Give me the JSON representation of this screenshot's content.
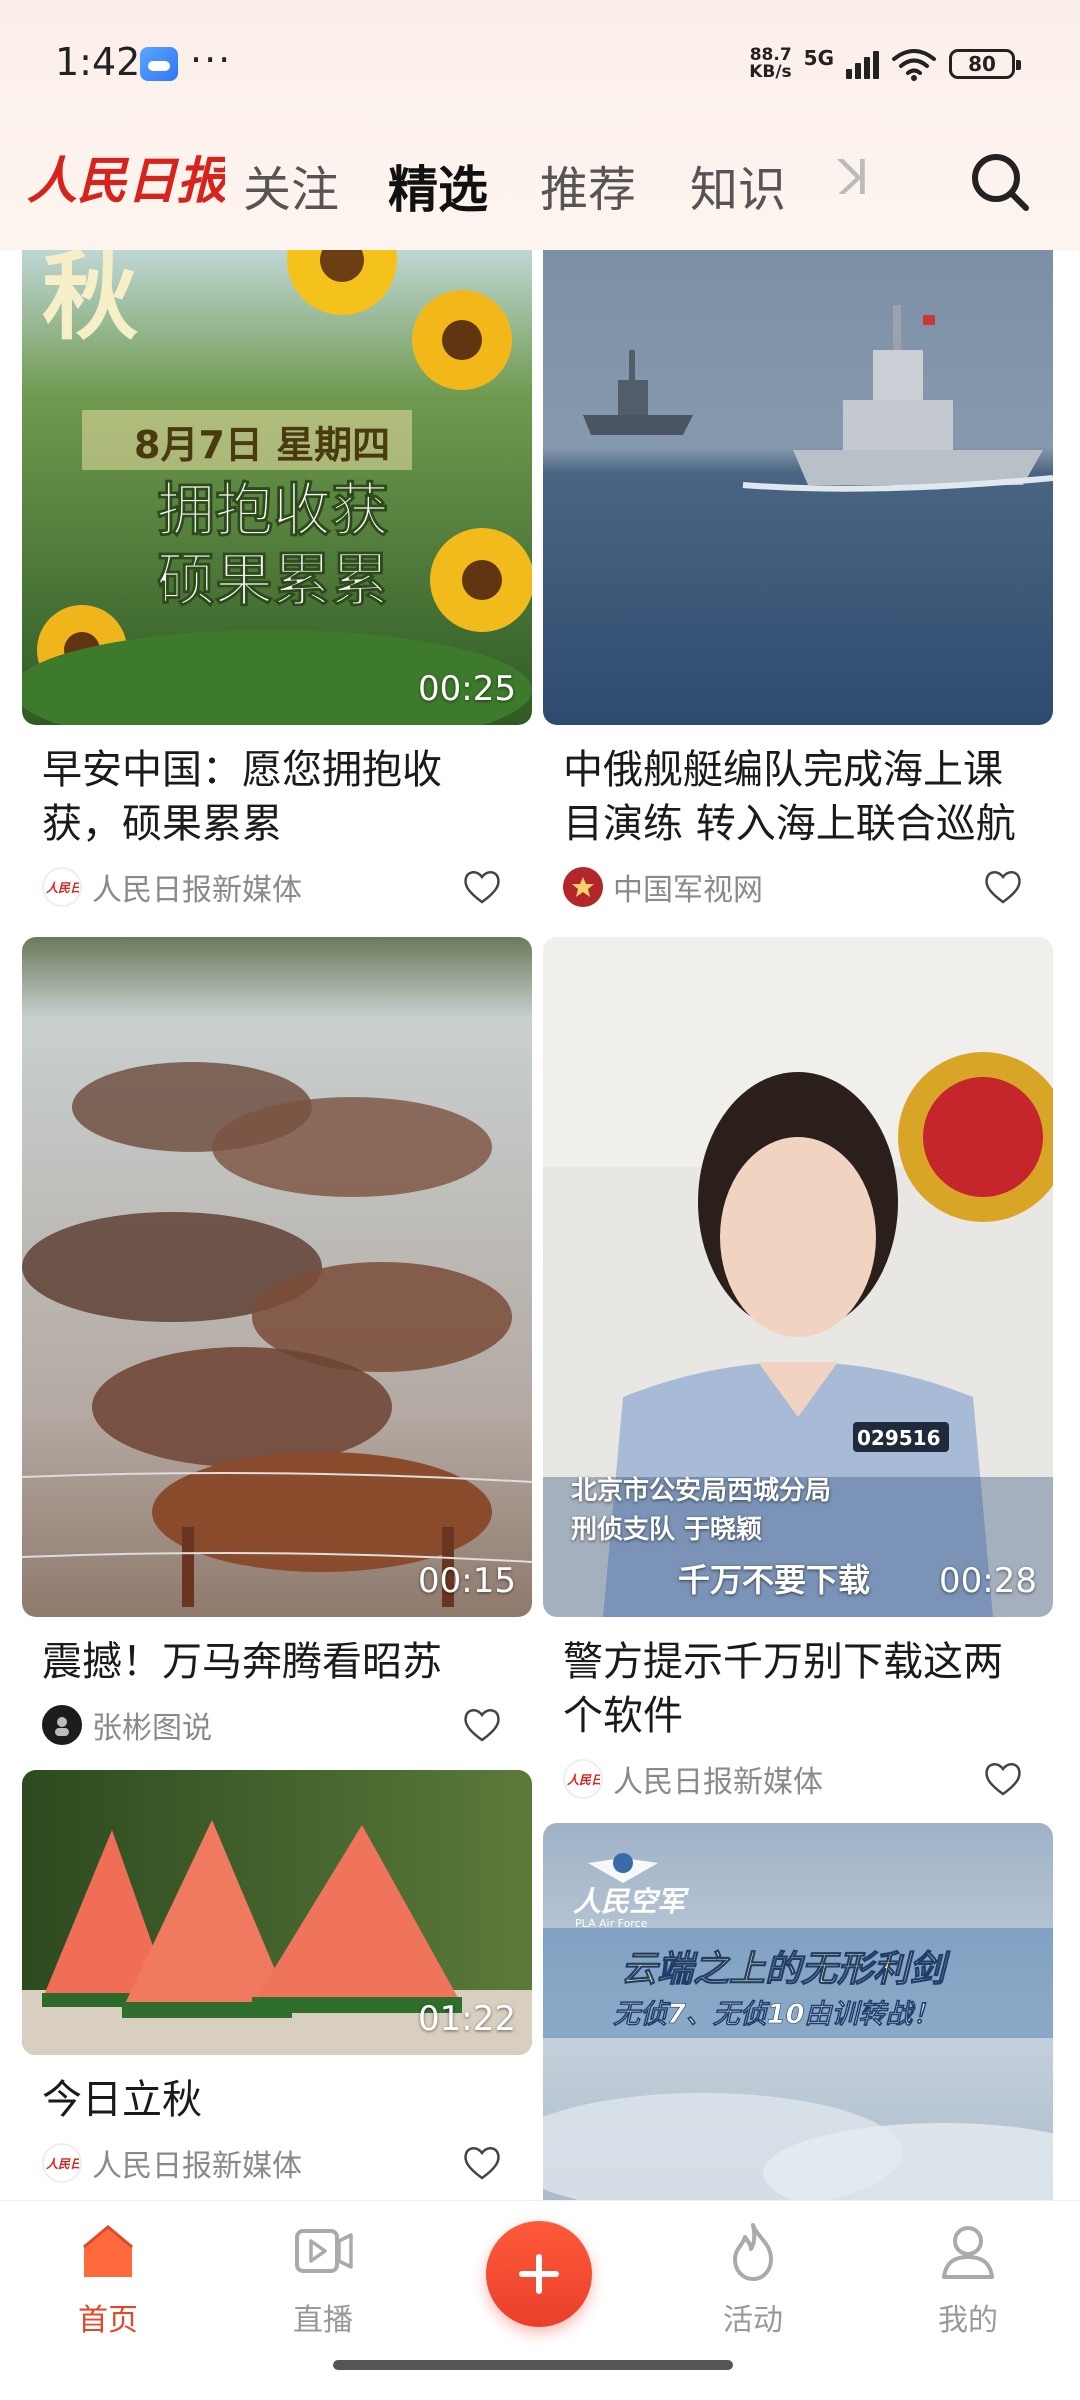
{
  "status": {
    "time": "1:42",
    "dots": "···",
    "net_speed_value": "88.7",
    "net_speed_unit": "KB/s",
    "network": "5G",
    "battery": "80"
  },
  "header": {
    "logo_text": "人民日报",
    "tabs": [
      {
        "label": "关注"
      },
      {
        "label": "精选",
        "active": true
      },
      {
        "label": "推荐"
      },
      {
        "label": "知识"
      },
      {
        "label": "ꓘ"
      }
    ]
  },
  "feed": {
    "cards": [
      {
        "thumb_overlay_date": "8月7日 星期四",
        "thumb_overlay_line1": "拥抱收获",
        "thumb_overlay_line2": "硕果累累",
        "thumb_overlay_corner": "秋",
        "duration": "00:25",
        "title": "早安中国：愿您拥抱收获，硕果累累",
        "source": "人民日报新媒体"
      },
      {
        "duration": "",
        "title": "中俄舰艇编队完成海上课目演练 转入海上联合巡航",
        "source": "中国军视网"
      },
      {
        "duration": "00:15",
        "title": "震撼！万马奔腾看昭苏",
        "source": "张彬图说"
      },
      {
        "thumb_caption_line1": "北京市公安局西城分局",
        "thumb_caption_line2": "刑侦支队 于晓颖",
        "thumb_caption_line3": "千万不要下载",
        "thumb_badge": "029516",
        "duration": "00:28",
        "title": "警方提示千万别下载这两个软件",
        "source": "人民日报新媒体"
      },
      {
        "duration": "01:22",
        "title": "今日立秋",
        "source": "人民日报新媒体"
      },
      {
        "thumb_brand": "人民空军",
        "thumb_brand_sub": "PLA Air Force",
        "thumb_headline": "云端之上的无形利剑",
        "thumb_subline": "无侦7、无侦10由训转战！"
      }
    ]
  },
  "bottom_nav": {
    "home": "首页",
    "live": "直播",
    "activity": "活动",
    "mine": "我的"
  },
  "colors": {
    "accent": "#e4482c",
    "header_bg": "#fbeee8"
  }
}
